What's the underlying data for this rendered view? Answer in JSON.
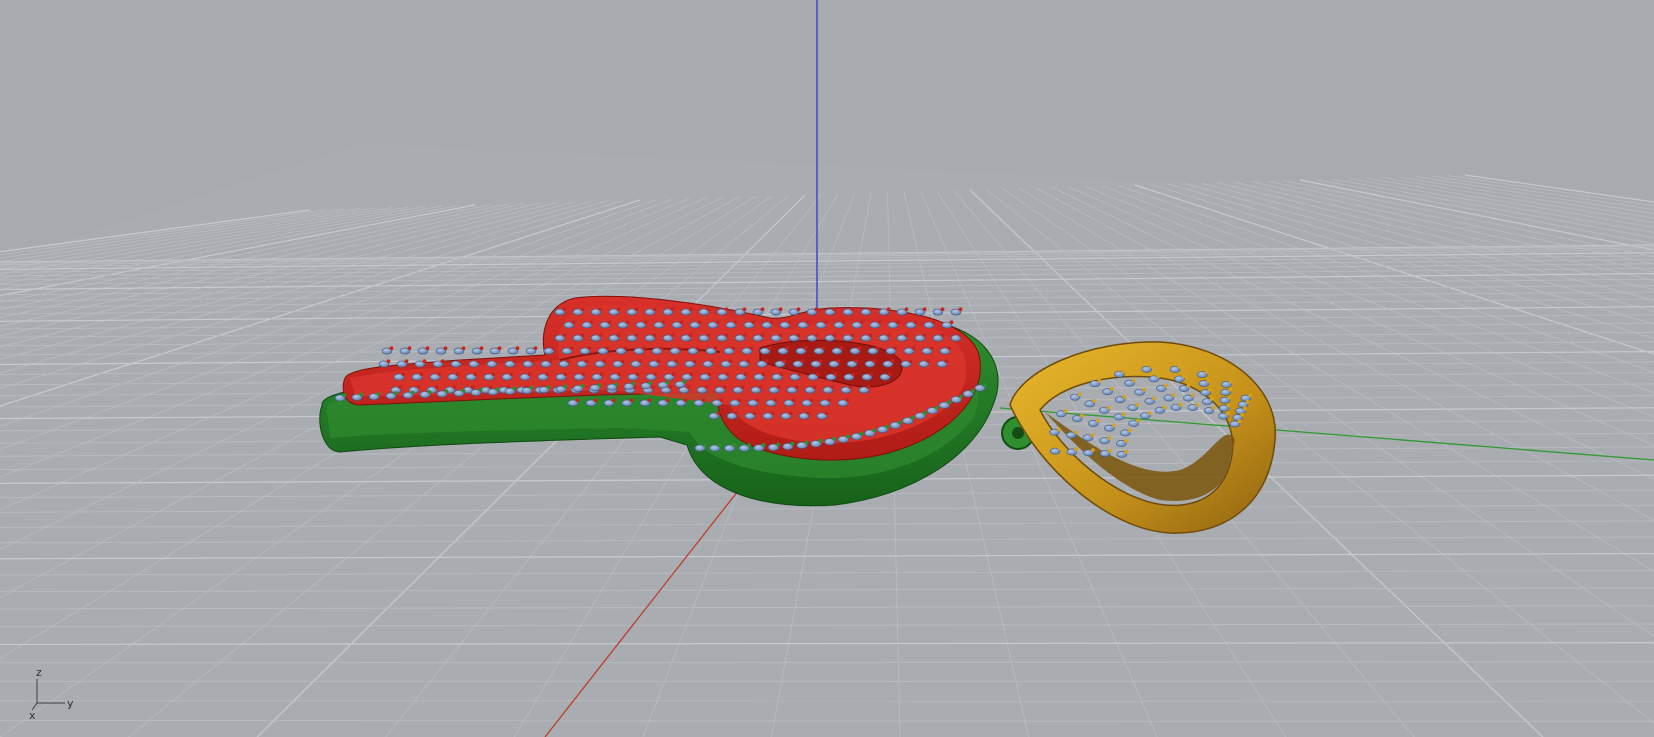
{
  "viewport": {
    "name": "Perspective",
    "background": "#a7abb0",
    "grid_minor_color": "#b9bdc2",
    "grid_major_color": "#c7cbcf"
  },
  "axes_colors": {
    "x": "#c0392b",
    "y": "#2f9a2f",
    "z": "#3c3ccf"
  },
  "model": {
    "type": "pendant",
    "parts": [
      {
        "name": "letter-top-layer",
        "color": "#c8231c"
      },
      {
        "name": "base-layer",
        "color": "#1f7a1f"
      },
      {
        "name": "bail-loop",
        "color": "#d6a21b"
      },
      {
        "name": "gemstones",
        "color": "#7d9bc9"
      }
    ]
  },
  "gizmo": {
    "z_label": "z",
    "y_label": "y",
    "x_label": "x"
  }
}
